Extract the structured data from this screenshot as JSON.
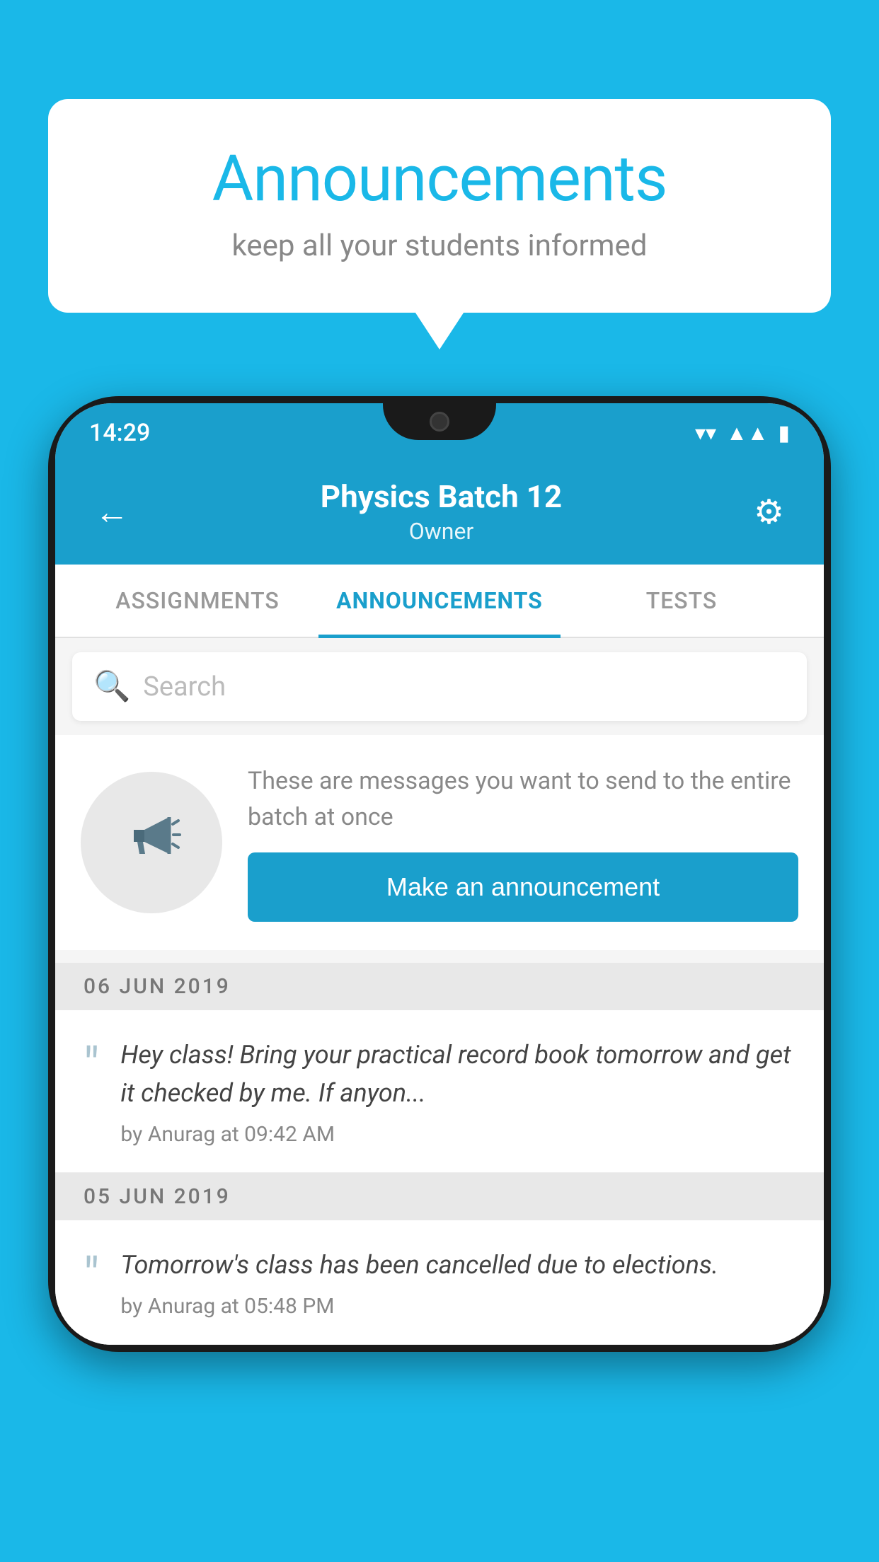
{
  "background_color": "#1ab8e8",
  "speech_bubble": {
    "title": "Announcements",
    "subtitle": "keep all your students informed"
  },
  "phone": {
    "status_bar": {
      "time": "14:29"
    },
    "app_bar": {
      "title": "Physics Batch 12",
      "subtitle": "Owner",
      "back_label": "←",
      "settings_label": "⚙"
    },
    "tabs": [
      {
        "label": "ASSIGNMENTS",
        "active": false
      },
      {
        "label": "ANNOUNCEMENTS",
        "active": true
      },
      {
        "label": "TESTS",
        "active": false
      }
    ],
    "search": {
      "placeholder": "Search"
    },
    "promo": {
      "description": "These are messages you want to send to the entire batch at once",
      "button_label": "Make an announcement"
    },
    "announcement_groups": [
      {
        "date": "06  JUN  2019",
        "items": [
          {
            "text": "Hey class! Bring your practical record book tomorrow and get it checked by me. If anyon...",
            "meta": "by Anurag at 09:42 AM"
          }
        ]
      },
      {
        "date": "05  JUN  2019",
        "items": [
          {
            "text": "Tomorrow's class has been cancelled due to elections.",
            "meta": "by Anurag at 05:48 PM"
          }
        ]
      }
    ]
  }
}
